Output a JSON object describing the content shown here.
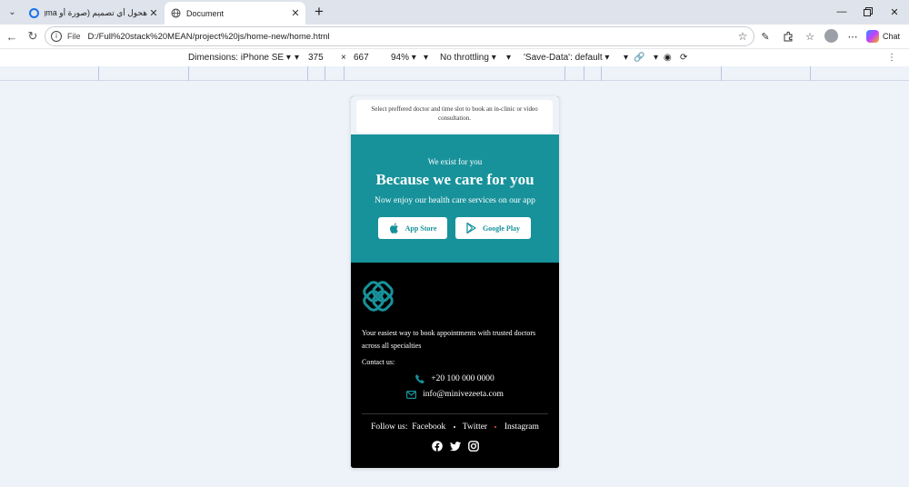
{
  "browser": {
    "tabs": [
      {
        "title": "هحول أي تصميم (صورة أو Figma) إ..."
      },
      {
        "title": "Document"
      }
    ],
    "address": {
      "scheme": "File",
      "url": "D:/Full%20stack%20MEAN/project%20js/home-new/home.html"
    },
    "chat_label": "Chat"
  },
  "devtools": {
    "dimensions": "Dimensions: iPhone SE",
    "width": "375",
    "times": "×",
    "height": "667",
    "zoom": "94%",
    "throttling": "No throttling",
    "save_data": "'Save-Data': default"
  },
  "page": {
    "intro_text": "Select preffered doctor and time slot to book an in-clinic or video consultation.",
    "hero": {
      "eyebrow": "We exist for you",
      "title": "Because we care for you",
      "subtitle": "Now enjoy our health care services on our app",
      "app_store_label": "App Store",
      "google_play_label": "Google Play"
    },
    "footer": {
      "tagline": "Your easiest way to book appointments with trusted doctors across all specialties",
      "contact_label": "Contact us:",
      "phone": "+20 100 000 0000",
      "email": "info@minivezeeta.com",
      "follow_label": "Follow us:",
      "links": [
        "Facebook",
        "Twitter",
        "Instagram"
      ]
    }
  },
  "colors": {
    "brand_teal": "#17929a",
    "footer_bg": "#000000",
    "page_bg": "#eef2f9"
  }
}
